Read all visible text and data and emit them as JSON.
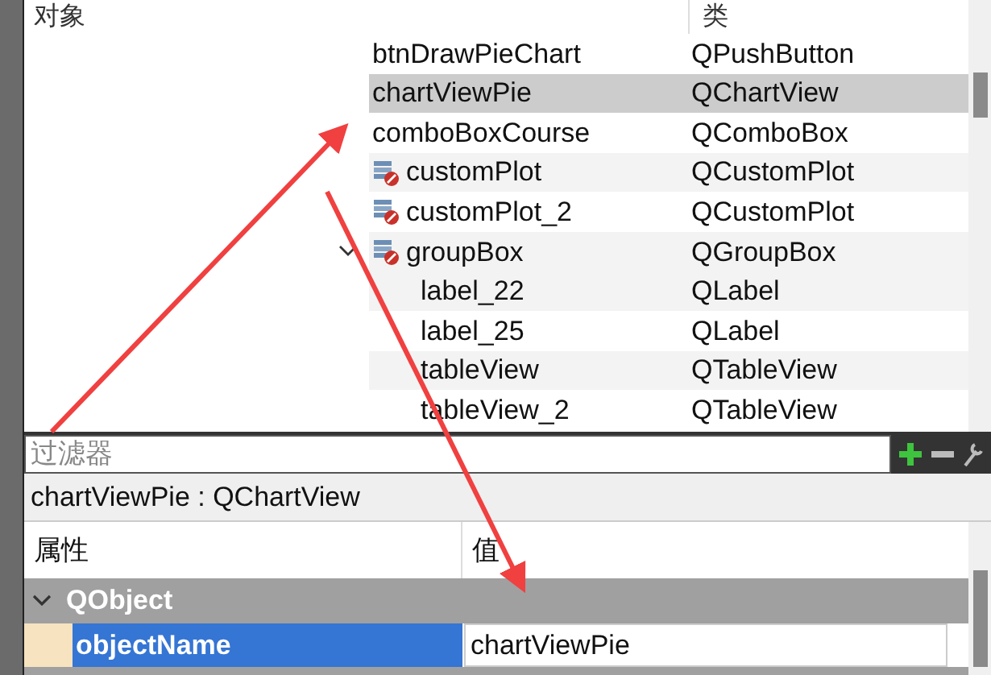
{
  "object_tree": {
    "columns": [
      "对象",
      "类"
    ],
    "rows": [
      {
        "name": "btnDrawPieChart",
        "class": "QPushButton",
        "selected": false
      },
      {
        "name": "chartViewPie",
        "class": "QChartView",
        "selected": true
      },
      {
        "name": "comboBoxCourse",
        "class": "QComboBox",
        "selected": false
      },
      {
        "name": "customPlot",
        "class": "QCustomPlot",
        "kind": "widget",
        "selected": false
      },
      {
        "name": "customPlot_2",
        "class": "QCustomPlot",
        "kind": "widget",
        "selected": false
      },
      {
        "name": "groupBox",
        "class": "QGroupBox",
        "kind": "widget",
        "selected": false,
        "expanded": true,
        "children": [
          {
            "name": "label_22",
            "class": "QLabel",
            "selected": false
          },
          {
            "name": "label_25",
            "class": "QLabel",
            "selected": false
          },
          {
            "name": "tableView",
            "class": "QTableView",
            "selected": false
          },
          {
            "name": "tableView_2",
            "class": "QTableView",
            "selected": false
          }
        ]
      }
    ]
  },
  "filter": {
    "placeholder": "过滤器"
  },
  "current_object": "chartViewPie : QChartView",
  "property_editor": {
    "columns": [
      "属性",
      "值"
    ],
    "groups": [
      {
        "name": "QObject",
        "expanded": true,
        "properties": [
          {
            "name": "objectName",
            "value": "chartViewPie",
            "selected": true
          }
        ]
      }
    ]
  }
}
